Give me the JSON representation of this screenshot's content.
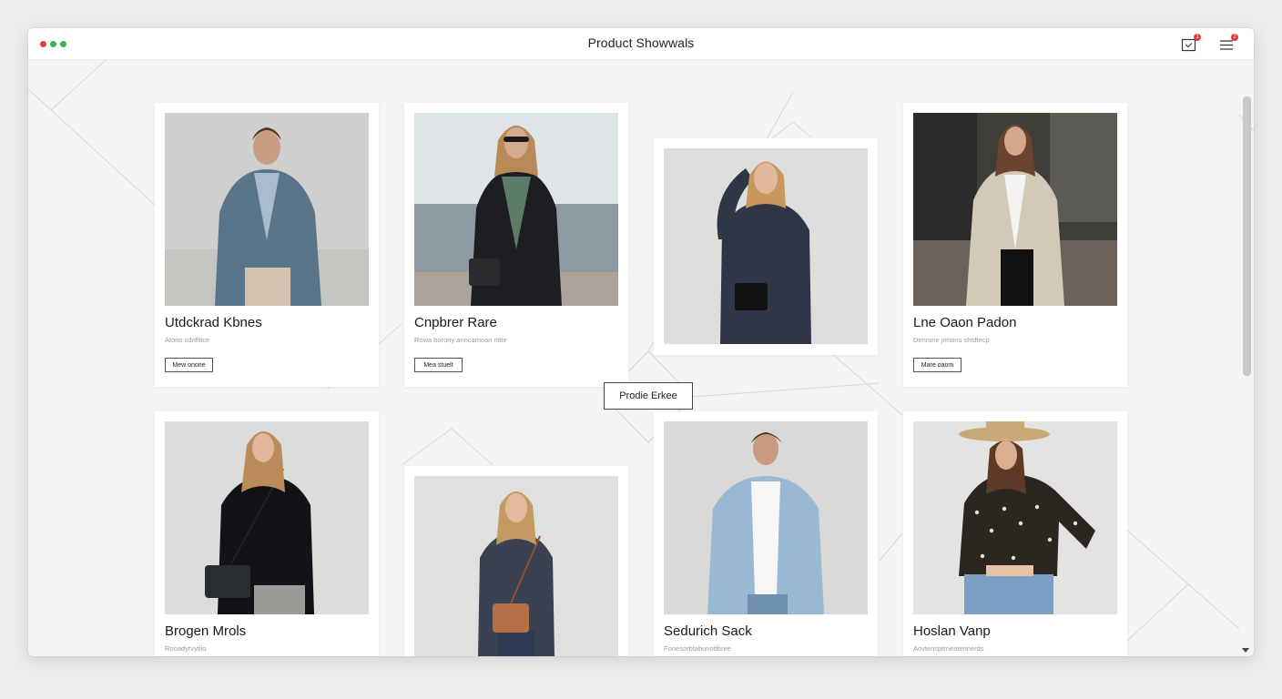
{
  "window": {
    "title": "Product Showwals"
  },
  "toolbar": {
    "notification_icon": "inbox-icon",
    "notification_count": "1",
    "menu_icon": "hamburger-menu-icon",
    "menu_count": "2"
  },
  "center_button": {
    "label": "Prodie Erkee"
  },
  "colors": {
    "accent_red": "#e03a3a",
    "window_green": "#3ab54a"
  },
  "products": [
    {
      "name": "Utdckrad Kbnes",
      "desc": "Atono sdrifitice",
      "button": "Mew onone"
    },
    {
      "name": "Cnpbrer Rare",
      "desc": "Rowa borony anncamoan rittie",
      "button": "Mea stuelt"
    },
    {
      "name": "",
      "desc": "",
      "button": ""
    },
    {
      "name": "Lne Oaon Padon",
      "desc": "Denrone jrmons shtdtecp",
      "button": "Mare oaom"
    },
    {
      "name": "Brogen Mrols",
      "desc": "Rooadyrvytiio",
      "button": ""
    },
    {
      "name": "",
      "desc": "",
      "button": ""
    },
    {
      "name": "Sedurich Sack",
      "desc": "Fonesorbtabunottbree",
      "button": ""
    },
    {
      "name": "Hoslan Vanp",
      "desc": "Aovtensptrneatennerds",
      "button": ""
    }
  ]
}
